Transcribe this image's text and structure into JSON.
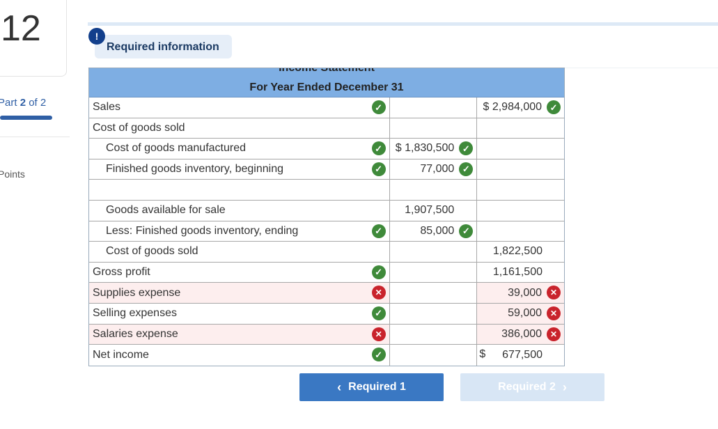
{
  "sidebar": {
    "question_number": "12",
    "part_prefix": "Part ",
    "part_current": "2",
    "part_suffix": " of 2",
    "points_label": "Points"
  },
  "header": {
    "alert_symbol": "!",
    "required_info": "Required information"
  },
  "statement": {
    "title": "Income Statement",
    "subtitle": "For Year Ended December 31",
    "rows": [
      {
        "label": "Sales",
        "mid": "",
        "right": "$ 2,984,000"
      },
      {
        "label": "Cost of goods sold",
        "mid": "",
        "right": ""
      },
      {
        "label": "Cost of goods manufactured",
        "mid": "$ 1,830,500",
        "right": ""
      },
      {
        "label": "Finished goods inventory, beginning",
        "mid": "77,000",
        "right": ""
      },
      {
        "label": "",
        "mid": "",
        "right": ""
      },
      {
        "label": "Goods available for sale",
        "mid": "1,907,500",
        "right": ""
      },
      {
        "label": "Less: Finished goods inventory, ending",
        "mid": "85,000",
        "right": ""
      },
      {
        "label": "Cost of goods sold",
        "mid": "",
        "right": "1,822,500"
      },
      {
        "label": "Gross profit",
        "mid": "",
        "right": "1,161,500"
      },
      {
        "label": "Supplies expense",
        "mid": "",
        "right": "39,000"
      },
      {
        "label": "Selling expenses",
        "mid": "",
        "right": "59,000"
      },
      {
        "label": "Salaries expense",
        "mid": "",
        "right": "386,000"
      },
      {
        "label": "Net income",
        "mid": "",
        "right_dollar": "$",
        "right": "677,500"
      }
    ]
  },
  "status_colors": {
    "correct": "#3f8a3a",
    "incorrect": "#c9232c",
    "header_blue": "#7eaee3"
  },
  "nav": {
    "prev_label": "Required 1",
    "next_label": "Required 2",
    "prev_icon": "chevron-left-icon",
    "next_icon": "chevron-right-icon"
  }
}
